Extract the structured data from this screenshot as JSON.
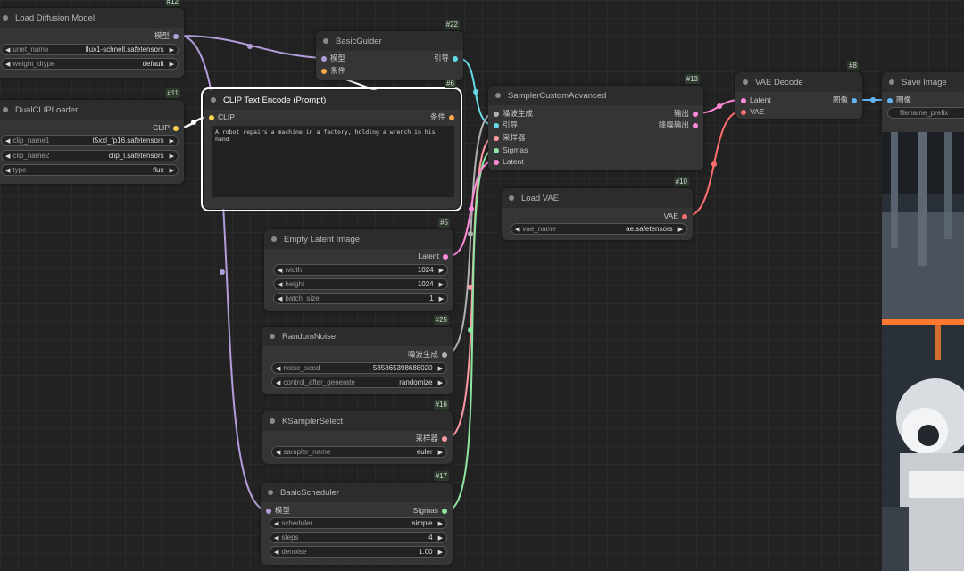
{
  "colors": {
    "model": "#b39ddb",
    "clip": "#ffd54f",
    "conditioning": "#ffa94d",
    "guider": "#66d9e8",
    "noise": "#b0b0b0",
    "sampler": "#ff9aa2",
    "sigmas": "#8ee6a0",
    "latent": "#ff8ad8",
    "vae": "#ff6e6e",
    "image": "#64b5f6"
  },
  "nodes": {
    "load_diffusion_model": {
      "id": "#12",
      "title": "Load Diffusion Model",
      "out_label": "模型",
      "widgets": [
        {
          "name": "unet_name",
          "value": "flux1-schnell.safetensors"
        },
        {
          "name": "weight_dtype",
          "value": "default"
        }
      ]
    },
    "dual_clip_loader": {
      "id": "#11",
      "title": "DualCLIPLoader",
      "out_label": "CLIP",
      "widgets": [
        {
          "name": "clip_name1",
          "value": "t5xxl_fp16.safetensors"
        },
        {
          "name": "clip_name2",
          "value": "clip_l.safetensors"
        },
        {
          "name": "type",
          "value": "flux"
        }
      ]
    },
    "basic_guider": {
      "id": "#22",
      "title": "BasicGuider",
      "in_model": "模型",
      "in_cond": "条件",
      "out_label": "引导"
    },
    "clip_text_encode": {
      "id": "#6",
      "title": "CLIP Text Encode (Prompt)",
      "in_label": "CLIP",
      "out_label": "条件",
      "text": "A robot repairs a machine in a factory, holding a wrench in his hand"
    },
    "sampler_custom_advanced": {
      "id": "#13",
      "title": "SamplerCustomAdvanced",
      "inputs": [
        "噪波生成",
        "引导",
        "采样器",
        "Sigmas",
        "Latent"
      ],
      "outputs": [
        "输出",
        "降噪输出"
      ]
    },
    "vae_decode": {
      "id": "#8",
      "title": "VAE Decode",
      "in_latent": "Latent",
      "in_vae": "VAE",
      "out_label": "图像"
    },
    "save_image": {
      "title": "Save Image",
      "in_label": "图像",
      "widget_name": "filename_prefix"
    },
    "load_vae": {
      "id": "#10",
      "title": "Load VAE",
      "out_label": "VAE",
      "widgets": [
        {
          "name": "vae_name",
          "value": "ae.safetensors"
        }
      ]
    },
    "empty_latent": {
      "id": "#5",
      "title": "Empty Latent Image",
      "out_label": "Latent",
      "widgets": [
        {
          "name": "width",
          "value": "1024"
        },
        {
          "name": "height",
          "value": "1024"
        },
        {
          "name": "batch_size",
          "value": "1"
        }
      ]
    },
    "random_noise": {
      "id": "#25",
      "title": "RandomNoise",
      "out_label": "噪波生成",
      "widgets": [
        {
          "name": "noise_seed",
          "value": "585865398688020"
        },
        {
          "name": "control_after_generate",
          "value": "randomize"
        }
      ]
    },
    "ksampler_select": {
      "id": "#16",
      "title": "KSamplerSelect",
      "out_label": "采样器",
      "widgets": [
        {
          "name": "sampler_name",
          "value": "euler"
        }
      ]
    },
    "basic_scheduler": {
      "id": "#17",
      "title": "BasicScheduler",
      "in_model": "模型",
      "out_label": "Sigmas",
      "widgets": [
        {
          "name": "scheduler",
          "value": "simple"
        },
        {
          "name": "steps",
          "value": "4"
        },
        {
          "name": "denoise",
          "value": "1.00"
        }
      ]
    }
  }
}
